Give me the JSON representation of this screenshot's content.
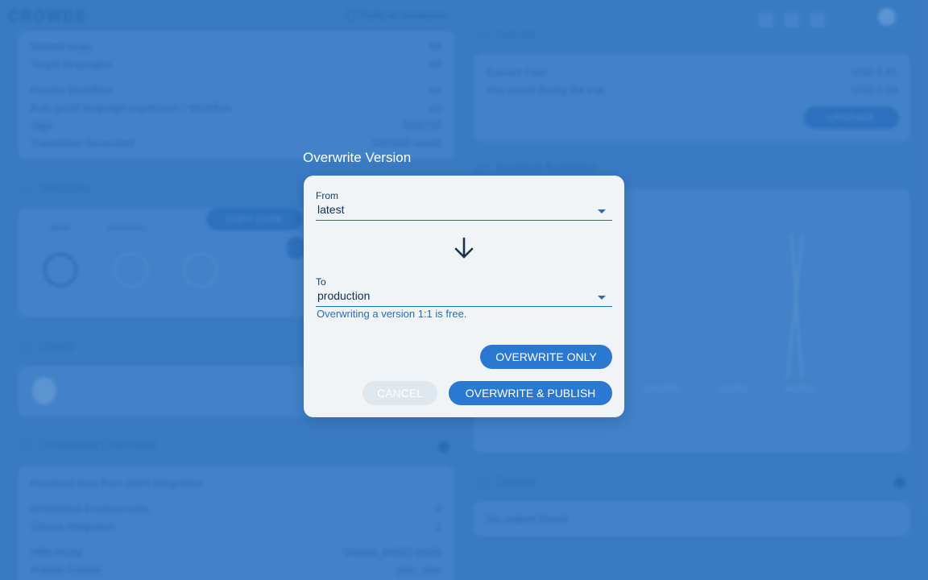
{
  "background": {
    "logo": "CROWDE",
    "notify_label": "Notify all developers",
    "stats_rows": [
      {
        "label": "Started langs",
        "value": "68"
      },
      {
        "label": "Target languages",
        "value": "45"
      },
      {
        "label": "Review Workflow",
        "value": "on"
      },
      {
        "label": "Auto-proof language-expression / Workflow",
        "value": "on"
      },
      {
        "label": "Tags",
        "value": "520/700"
      },
      {
        "label": "Translation Generated",
        "value": "50/5000 words"
      }
    ],
    "versions_title": "Versions",
    "copy_button": "COPY CODE",
    "version_labels": [
      "latest",
      "production"
    ],
    "users_title": "Users",
    "dev_title": "Developer Overview",
    "dev_rows": [
      {
        "label": "Received keys from client integration",
        "value": ""
      },
      {
        "label": "Whitelisted Environments",
        "value": "0"
      },
      {
        "label": "Glossa integration",
        "value": "1"
      },
      {
        "label": "Hilfe-Portal",
        "value": "Shared_tr0923 bbt3b"
      },
      {
        "label": "Publish Format",
        "value": "json_ssor"
      }
    ],
    "cost_title": "Cost Info",
    "current_cost_label": "Current Cost",
    "current_cost_value": "USD 5.41",
    "saved_label": "You saved during the trial",
    "saved_value": "USD 0.84",
    "upgrade_button": "UPGRADE",
    "analytics_title": "Content Analytics",
    "chart_ticks": [
      "10/1/2020",
      "1/1/2021",
      "3/1/2021"
    ],
    "orders_title": "Orders",
    "orders_empty": "No orders found"
  },
  "dialog": {
    "title": "Overwrite Version",
    "from_label": "From",
    "from_value": "latest",
    "to_label": "To",
    "to_value": "production",
    "hint": "Overwriting a version 1:1 is free.",
    "overwrite_only": "OVERWRITE ONLY",
    "cancel": "CANCEL",
    "overwrite_publish": "OVERWRITE & PUBLISH"
  }
}
